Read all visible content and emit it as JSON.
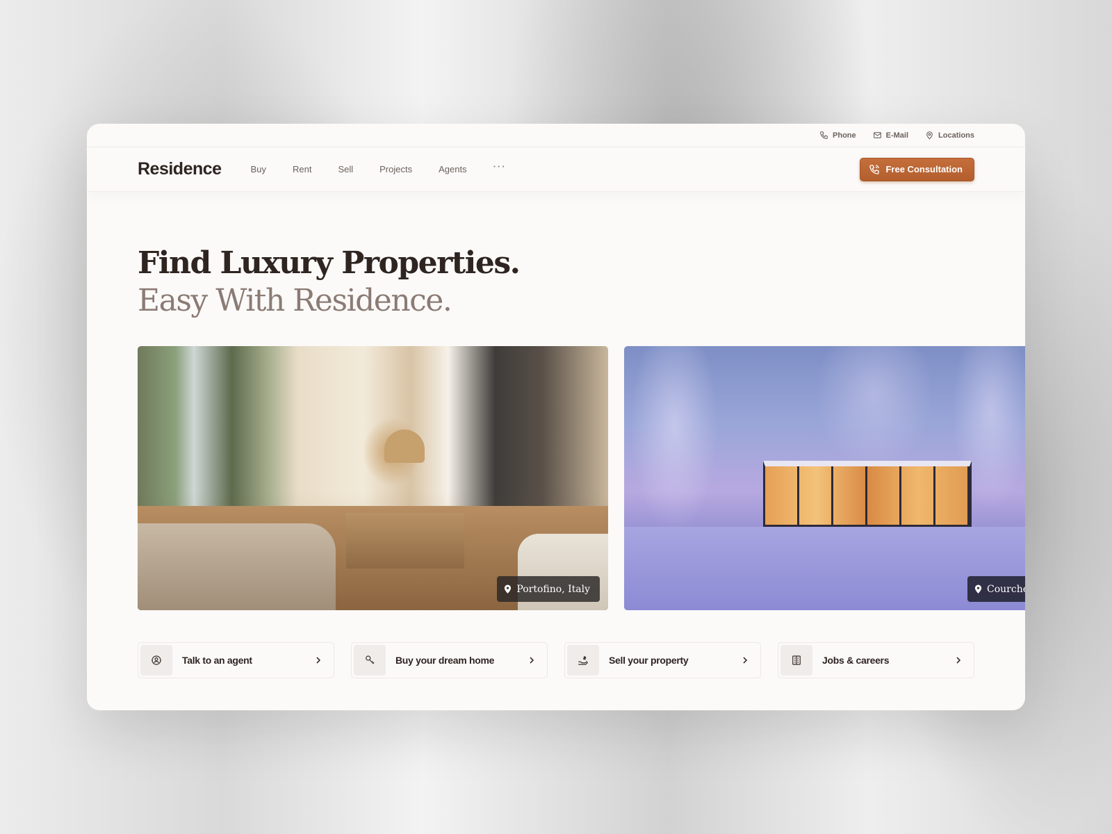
{
  "topbar": {
    "items": [
      {
        "label": "Phone",
        "icon": "phone-icon"
      },
      {
        "label": "E-Mail",
        "icon": "mail-icon"
      },
      {
        "label": "Locations",
        "icon": "location-pin-icon"
      }
    ]
  },
  "nav": {
    "logo": "Residence",
    "links": [
      "Buy",
      "Rent",
      "Sell",
      "Projects",
      "Agents"
    ],
    "more": "···",
    "cta_label": "Free Consultation",
    "cta_icon": "phone-icon"
  },
  "hero": {
    "title": "Find Luxury Properties.",
    "subtitle": "Easy With Residence."
  },
  "gallery": [
    {
      "location": "Portofino, Italy"
    },
    {
      "location": "Courche"
    }
  ],
  "actions": [
    {
      "label": "Talk to an agent",
      "icon": "agent-icon"
    },
    {
      "label": "Buy your dream home",
      "icon": "key-icon"
    },
    {
      "label": "Sell your property",
      "icon": "hand-money-icon"
    },
    {
      "label": "Jobs & careers",
      "icon": "building-icon"
    }
  ],
  "colors": {
    "accent": "#b9622f",
    "text_dark": "#2e2420",
    "text_muted": "#8b7b74",
    "card_bg": "#fbfaf9"
  }
}
